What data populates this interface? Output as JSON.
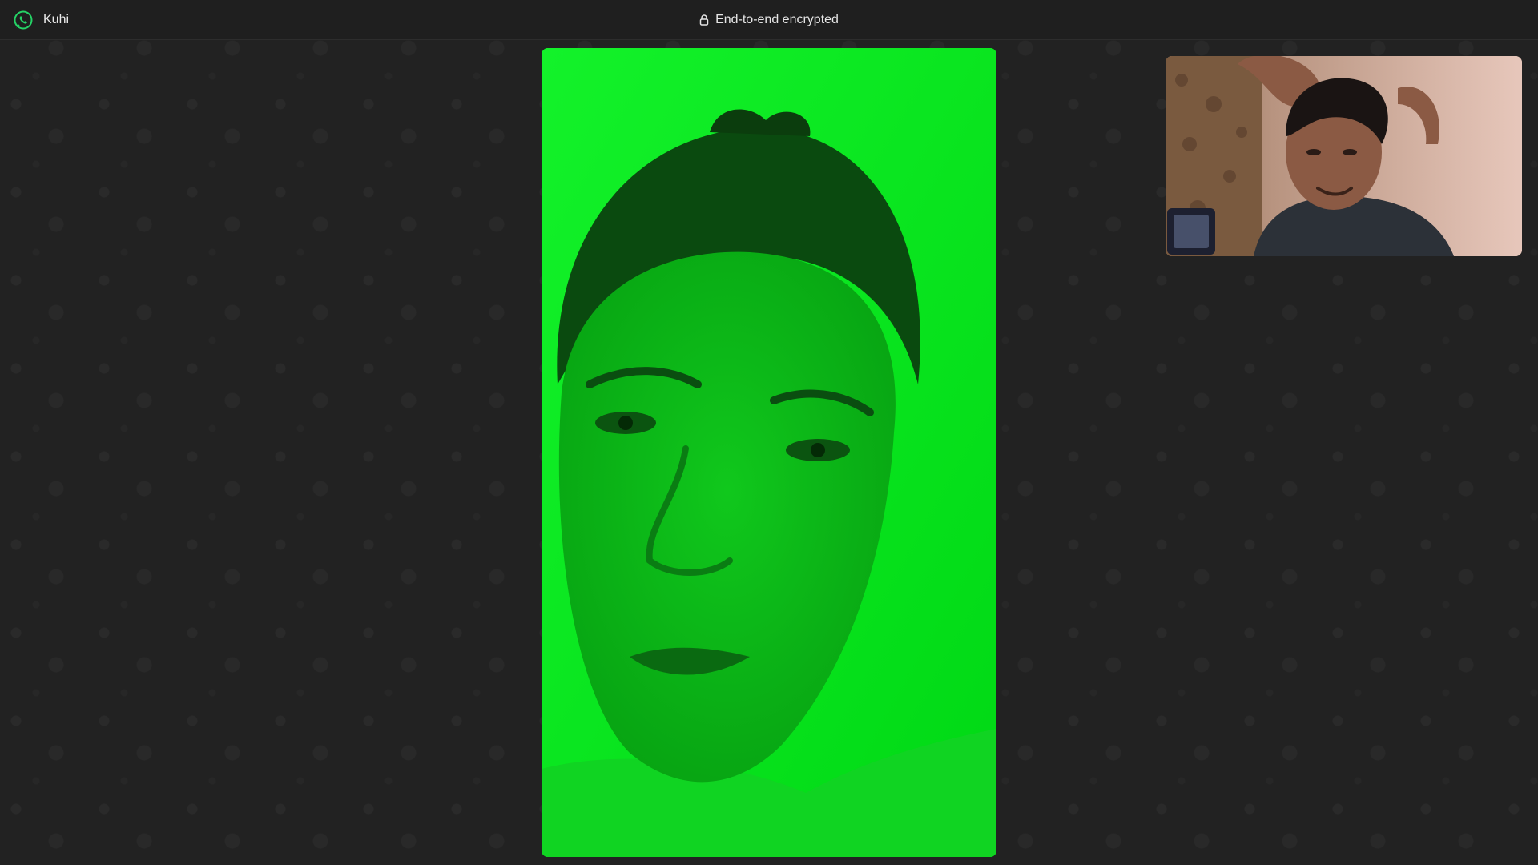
{
  "titlebar": {
    "contact_name": "Kuhi",
    "app_icon": "whatsapp-icon",
    "encryption_icon": "lock-icon",
    "encryption_label": "End-to-end encrypted"
  },
  "main_video": {
    "description_icon": "remote-participant-video",
    "tint_color": "#00e81a"
  },
  "self_view": {
    "description_icon": "self-view-video"
  },
  "colors": {
    "background": "#222222",
    "titlebar": "#1f1f1f",
    "brand": "#25d366"
  }
}
